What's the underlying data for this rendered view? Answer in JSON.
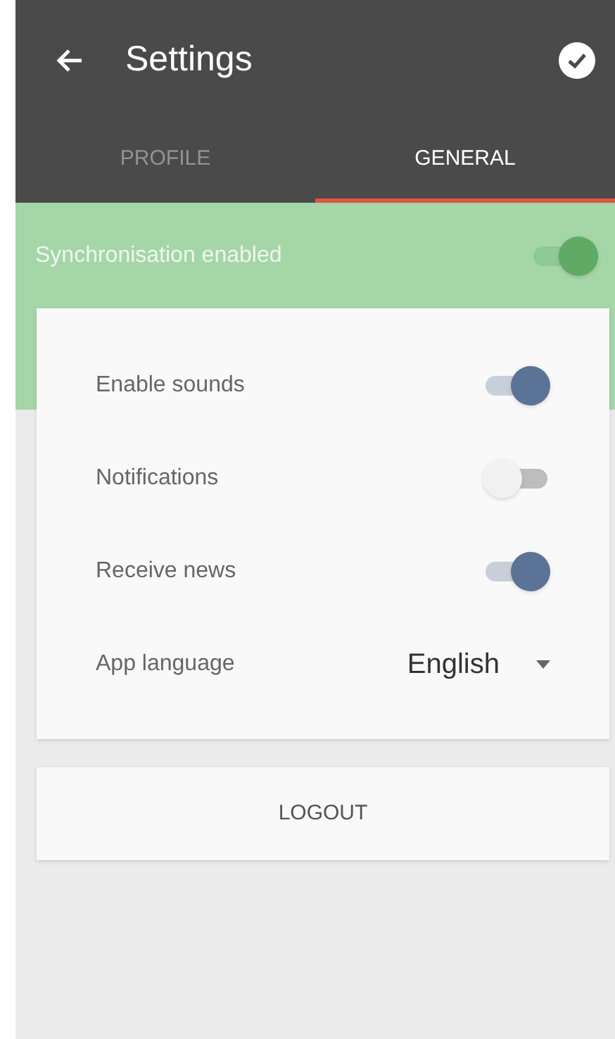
{
  "header": {
    "title": "Settings"
  },
  "tabs": [
    {
      "label": "PROFILE",
      "selected": false
    },
    {
      "label": "GENERAL",
      "selected": true
    }
  ],
  "sync": {
    "label": "Synchronisation enabled",
    "on": true
  },
  "settings": [
    {
      "kind": "toggle",
      "label": "Enable sounds",
      "on": true
    },
    {
      "kind": "toggle",
      "label": "Notifications",
      "on": false
    },
    {
      "kind": "toggle",
      "label": "Receive news",
      "on": true
    },
    {
      "kind": "dropdown",
      "label": "App language",
      "value": "English"
    }
  ],
  "logout": {
    "label": "LOGOUT"
  }
}
